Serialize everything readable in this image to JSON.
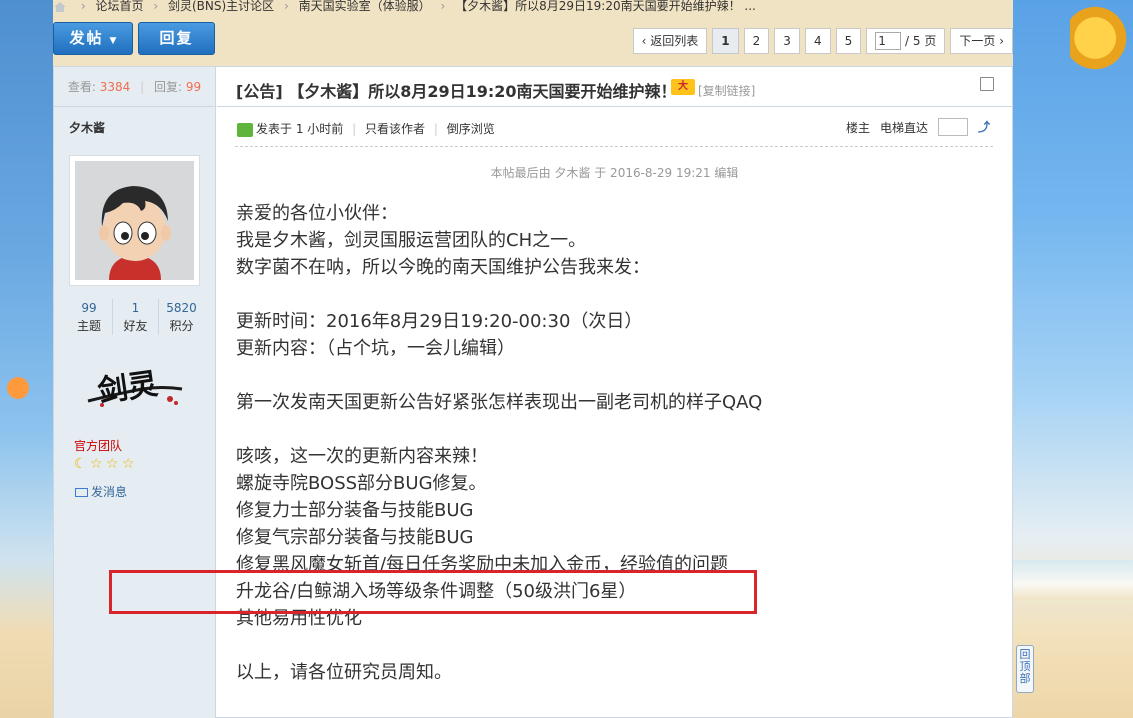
{
  "breadcrumb": {
    "items": [
      "论坛首页",
      "剑灵(BNS)主讨论区",
      "南天国实验室（体验服）",
      "【夕木酱】所以8月29日19:20南天国要开始维护辣！ ..."
    ]
  },
  "toolbar": {
    "post_label": "发帖",
    "reply_label": "回复"
  },
  "pager": {
    "back_label": "返回列表",
    "pages": [
      "1",
      "2",
      "3",
      "4",
      "5"
    ],
    "current_page": "1",
    "input_value": "1",
    "total_label": "/ 5 页",
    "next_label": "下一页"
  },
  "sidebar": {
    "views_label": "查看:",
    "views": "3384",
    "replies_label": "回复:",
    "replies": "99",
    "author": "夕木酱",
    "stats": [
      {
        "value": "99",
        "label": "主题"
      },
      {
        "value": "1",
        "label": "好友"
      },
      {
        "value": "5820",
        "label": "积分"
      }
    ],
    "logo_text": "剑灵",
    "group": "官方团队",
    "message_label": "发消息"
  },
  "post": {
    "title": "[公告] 【夕木酱】所以8月29日19:20南天国要开始维护辣！",
    "title_tag": "大",
    "copy_link": "[复制链接]",
    "posted_at": "发表于 1 小时前",
    "only_author": "只看该作者",
    "reverse": "倒序浏览",
    "floor_label": "楼主",
    "jump_label": "电梯直达",
    "edited_note": "本帖最后由 夕木酱 于 2016-8-29 19:21 编辑",
    "lines": [
      "亲爱的各位小伙伴：",
      "我是夕木酱，剑灵国服运营团队的CH之一。",
      "数字菌不在呐，所以今晚的南天国维护公告我来发：",
      "",
      "更新时间：2016年8月29日19:20-00:30（次日）",
      "更新内容：（占个坑，一会儿编辑）",
      "",
      "第一次发南天国更新公告好紧张怎样表现出一副老司机的样子QAQ",
      "",
      "咳咳，这一次的更新内容来辣！",
      "螺旋寺院BOSS部分BUG修复。",
      "修复力士部分装备与技能BUG",
      "修复气宗部分装备与技能BUG",
      "修复黑风魔女斩首/每日任务奖励中未加入金币，经验值的问题",
      "升龙谷/白鲸湖入场等级条件调整（50级洪门6星）",
      "其他易用性优化",
      "",
      "以上，请各位研究员周知。"
    ]
  },
  "back_to_top": "回顶部",
  "colors": {
    "button_blue": "#2a7fd0",
    "highlight": "#d9242b",
    "sidebar_bg": "#e5edf2",
    "count_orange": "#f26c4f"
  },
  "icons": [
    "home-icon",
    "print-icon",
    "post-time-icon",
    "jump-icon",
    "mail-icon",
    "star-icon",
    "moon-icon"
  ]
}
